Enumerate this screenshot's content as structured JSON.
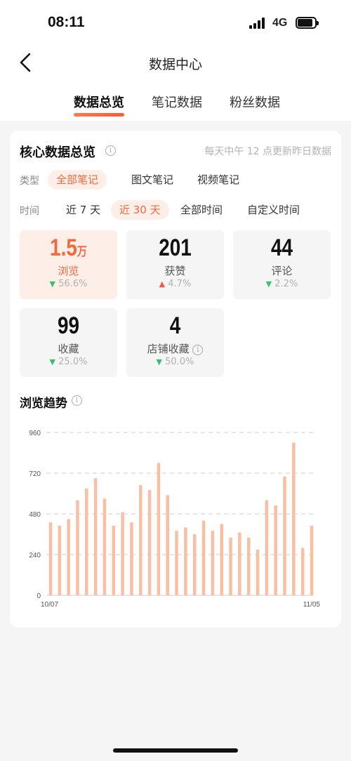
{
  "status_bar": {
    "time": "08:11",
    "network": "4G"
  },
  "header": {
    "title": "数据中心"
  },
  "tabs": [
    {
      "label": "数据总览",
      "active": true
    },
    {
      "label": "笔记数据",
      "active": false
    },
    {
      "label": "粉丝数据",
      "active": false
    }
  ],
  "overview": {
    "title": "核心数据总览",
    "update_note": "每天中午 12 点更新昨日数据",
    "type_filter": {
      "label": "类型",
      "options": [
        "全部笔记",
        "图文笔记",
        "视频笔记"
      ],
      "selected": "全部笔记"
    },
    "time_filter": {
      "label": "时间",
      "options": [
        "近 7 天",
        "近 30 天",
        "全部时间",
        "自定义时间"
      ],
      "selected": "近 30 天"
    },
    "metrics": [
      {
        "value": "1.5",
        "unit": "万",
        "label": "浏览",
        "change": "56.6%",
        "direction": "down",
        "active": true
      },
      {
        "value": "201",
        "unit": "",
        "label": "获赞",
        "change": "4.7%",
        "direction": "up",
        "active": false
      },
      {
        "value": "44",
        "unit": "",
        "label": "评论",
        "change": "2.2%",
        "direction": "down",
        "active": false
      },
      {
        "value": "99",
        "unit": "",
        "label": "收藏",
        "change": "25.0%",
        "direction": "down",
        "active": false
      },
      {
        "value": "4",
        "unit": "",
        "label": "店铺收藏",
        "change": "50.0%",
        "direction": "down",
        "active": false,
        "info": true
      }
    ]
  },
  "trend": {
    "title": "浏览趋势"
  },
  "colors": {
    "accent": "#f06a3e",
    "bar": "#f8bfa5",
    "up": "#ee5a3a",
    "down": "#38c172"
  },
  "chart_data": {
    "type": "bar",
    "title": "浏览趋势",
    "x_start_label": "10/07",
    "x_end_label": "11/05",
    "y_ticks": [
      0,
      240,
      480,
      720,
      960
    ],
    "ylim": [
      0,
      960
    ],
    "grid": true,
    "values": [
      430,
      410,
      450,
      560,
      630,
      690,
      570,
      410,
      490,
      430,
      650,
      620,
      780,
      590,
      380,
      400,
      360,
      440,
      380,
      420,
      340,
      370,
      340,
      270,
      560,
      530,
      700,
      900,
      280,
      410
    ]
  }
}
